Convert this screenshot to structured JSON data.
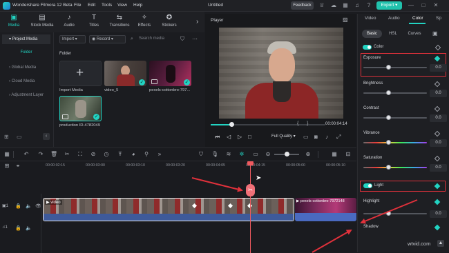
{
  "titlebar": {
    "app_name": "Wondershare Filmora 12 Beta",
    "menus": [
      "File",
      "Edit",
      "Tools",
      "View",
      "Help"
    ],
    "project_title": "Untitled",
    "feedback_label": "Feedback",
    "export_label": "Export"
  },
  "main_tabs": [
    {
      "label": "Media",
      "icon": "media-icon"
    },
    {
      "label": "Stock Media",
      "icon": "stock-media-icon"
    },
    {
      "label": "Audio",
      "icon": "audio-icon"
    },
    {
      "label": "Titles",
      "icon": "titles-icon"
    },
    {
      "label": "Transitions",
      "icon": "transitions-icon"
    },
    {
      "label": "Effects",
      "icon": "effects-icon"
    },
    {
      "label": "Stickers",
      "icon": "stickers-icon"
    }
  ],
  "left_nav": {
    "project_media": "Project Media",
    "folder": "Folder",
    "global_media": "Global Media",
    "cloud_media": "Cloud Media",
    "adjustment_layer": "Adjustment Layer"
  },
  "media_pane": {
    "import_label": "Import",
    "record_label": "Record",
    "search_placeholder": "Search media",
    "folder_heading": "Folder",
    "items": [
      {
        "label": "Import Media"
      },
      {
        "label": "video_5"
      },
      {
        "label": "pexels-cottonbro-797..."
      },
      {
        "label": "production ID-4782049"
      }
    ]
  },
  "player": {
    "title": "Player",
    "timecode": "00:00:04:14",
    "quality": "Full Quality",
    "progress": 0.18
  },
  "right_panel": {
    "tabs": [
      "Video",
      "Audio",
      "Color",
      "Sp"
    ],
    "active_tab": "Color",
    "subtabs": [
      "Basic",
      "HSL",
      "Curves"
    ],
    "active_subtab": "Basic",
    "color_section": "Color",
    "exposure": {
      "label": "Exposure",
      "value": "0.0"
    },
    "brightness": {
      "label": "Brightness",
      "value": "0.0"
    },
    "contrast": {
      "label": "Contrast",
      "value": "0.0"
    },
    "vibrance": {
      "label": "Vibrance",
      "value": "0.0"
    },
    "saturation": {
      "label": "Saturation",
      "value": "0.0"
    },
    "light_section": "Light",
    "highlight": {
      "label": "Highlight",
      "value": "0.0"
    },
    "shadow": {
      "label": "Shadow"
    },
    "accent": "#22d3c2"
  },
  "timeline": {
    "ruler": [
      "00:00:02:15",
      "00:00:03:00",
      "00:00:03:10",
      "00:00:03:20",
      "00:00:04:05",
      "00:00:04:15",
      "00:00:05:00",
      "00:00:05:10"
    ],
    "clip1_label": "video",
    "clip2_label": "pexels-cottonbro-7972148",
    "track_video": "1",
    "track_audio": "1"
  },
  "watermark": "wtvid.com"
}
